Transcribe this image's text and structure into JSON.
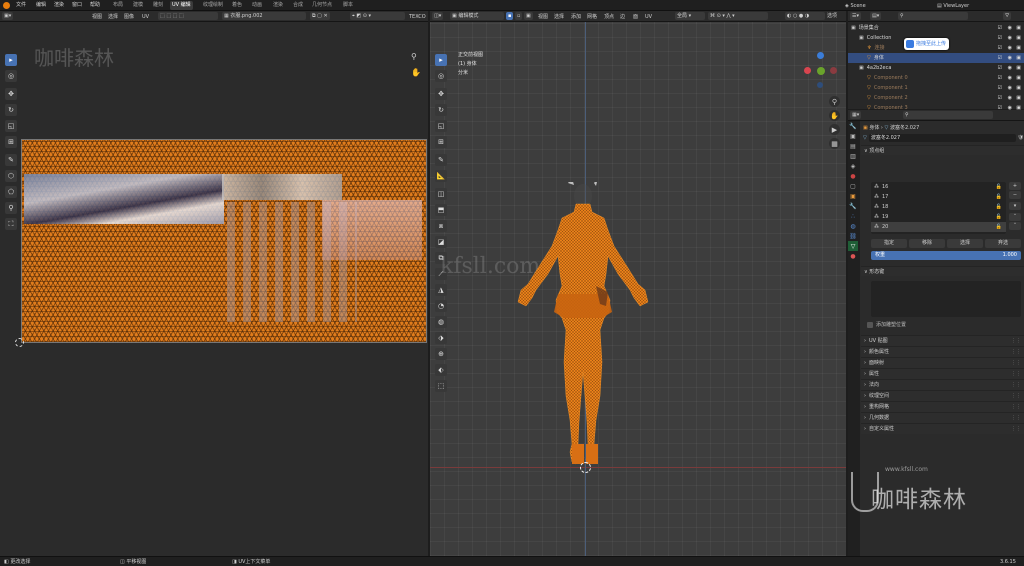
{
  "app": {
    "menus": [
      "文件",
      "编辑",
      "渲染",
      "窗口",
      "帮助"
    ],
    "workspaces": [
      "布局",
      "建模",
      "雕刻",
      "UV 编辑",
      "纹理绘制",
      "着色",
      "动画",
      "渲染",
      "合成",
      "几何节点",
      "脚本"
    ],
    "active_workspace": "UV 编辑",
    "scene": "Scene",
    "view_layer": "ViewLayer"
  },
  "uv_editor": {
    "menus": [
      "视图",
      "选择",
      "图像",
      "UV"
    ],
    "image_name": "衣服.png.002",
    "texcoord": "TEXCO"
  },
  "viewport": {
    "mode": "编辑模式",
    "menus": [
      "视图",
      "选择",
      "添加",
      "网格",
      "顶点",
      "边",
      "面",
      "UV"
    ],
    "orientation": "全局",
    "shading": "选项",
    "overlay_title": "正交前视图",
    "overlay_object": "(1) 身体",
    "overlay_unit": "分米"
  },
  "outliner": {
    "items": [
      {
        "name": "场景集合",
        "indent": 0,
        "icon": "collection-icon",
        "color": "#cfcfcf",
        "hl": false
      },
      {
        "name": "Collection",
        "indent": 1,
        "icon": "collection-icon",
        "color": "#cfcfcf",
        "hl": false
      },
      {
        "name": "连接",
        "indent": 2,
        "icon": "armature-icon",
        "color": "#e89a3c",
        "hl": false
      },
      {
        "name": "身体",
        "indent": 2,
        "icon": "mesh-icon",
        "color": "#e89a3c",
        "hl": true
      },
      {
        "name": "4a2b2eca",
        "indent": 1,
        "icon": "collection-icon",
        "color": "#cfcfcf",
        "hl": false
      },
      {
        "name": "Component 0",
        "indent": 2,
        "icon": "mesh-icon",
        "color": "#e89a3c",
        "hl": false
      },
      {
        "name": "Component 1",
        "indent": 2,
        "icon": "mesh-icon",
        "color": "#e89a3c",
        "hl": false
      },
      {
        "name": "Component 2",
        "indent": 2,
        "icon": "mesh-icon",
        "color": "#e89a3c",
        "hl": false
      },
      {
        "name": "Component 3",
        "indent": 2,
        "icon": "mesh-icon",
        "color": "#e89a3c",
        "hl": false
      }
    ],
    "badge": "拖拽至此上传"
  },
  "properties": {
    "breadcrumb_obj": "身体",
    "breadcrumb_mesh": "波塞冬2.027",
    "mesh_name": "波塞冬2.027",
    "vertex_groups_title": "顶点组",
    "vertex_groups": [
      "16",
      "17",
      "18",
      "19",
      "20"
    ],
    "vg_buttons": [
      "指定",
      "移除",
      "选择",
      "弃选"
    ],
    "weight_label": "权重",
    "weight_value": "1.000",
    "shape_keys_title": "形态键",
    "auto_smooth": "添加雕塑位置",
    "sections": [
      "UV 贴图",
      "颜色属性",
      "面映射",
      "属性",
      "法向",
      "纹理空间",
      "重构网格",
      "几何数据",
      "自定义属性"
    ]
  },
  "status": {
    "items": [
      "更改选择",
      "平移视图",
      "UV上下文菜单"
    ],
    "version": "3.6.15"
  },
  "watermark": {
    "brand": "咖啡森林",
    "url": "www.kfsll.com",
    "mid": "kfsll.com"
  },
  "colors": {
    "accent": "#4772b3",
    "select": "#ff8c1a",
    "bg": "#3d3d3d"
  }
}
